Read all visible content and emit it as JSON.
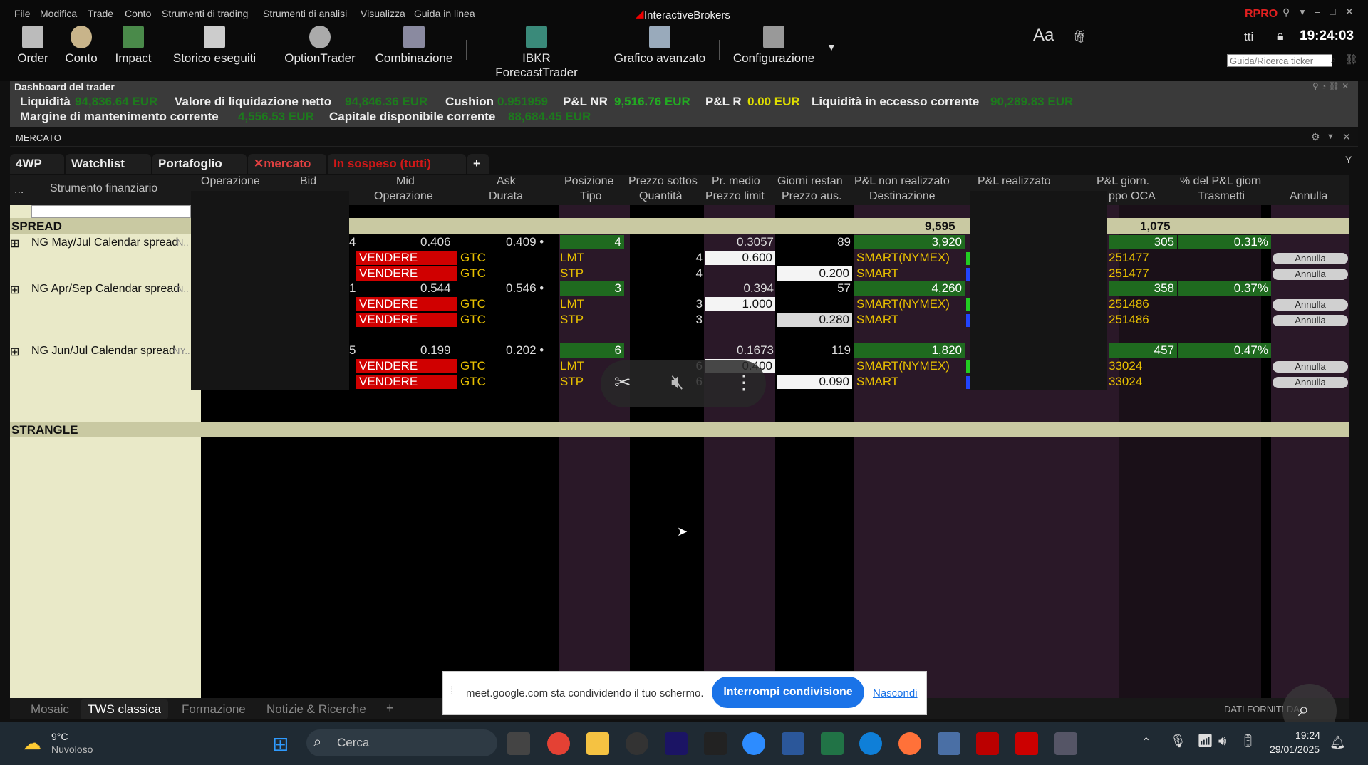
{
  "menu": {
    "file": "File",
    "edit": "Modifica",
    "trade": "Trade",
    "account": "Conto",
    "trading_tools": "Strumenti di trading",
    "analysis_tools": "Strumenti di analisi",
    "view": "Visualizza",
    "help": "Guida in linea"
  },
  "brand": "InteractiveBrokers",
  "pro_label": "RPRO",
  "clock": "19:24:03",
  "ticker_search_placeholder": "Guida/Ricerca ticker",
  "font_size_label": "Aa",
  "toolbar": {
    "order": "Order",
    "account": "Conto",
    "impact": "Impact",
    "trades": "Storico eseguiti",
    "optiontrader": "OptionTrader",
    "combo": "Combinazione",
    "forecast": "IBKR ForecastTrader",
    "chart": "Grafico avanzato",
    "config": "Configurazione"
  },
  "dashboard": {
    "title": "Dashboard del trader",
    "liq_label": "Liquidità",
    "liq_value": "94,836.64 EUR",
    "net_liq_label": "Valore di liquidazione netto",
    "net_liq_value": "94,846.36 EUR",
    "cushion_label": "Cushion",
    "cushion_value": "0.951959",
    "pnl_nr_label": "P&L NR",
    "pnl_nr_value": "9,516.76 EUR",
    "pnl_r_label": "P&L R",
    "pnl_r_value": "0.00 EUR",
    "excess_label": "Liquidità in eccesso corrente",
    "excess_value": "90,289.83 EUR",
    "margin_label": "Margine di mantenimento corrente",
    "margin_value": "4,556.53 EUR",
    "avail_label": "Capitale disponibile corrente",
    "avail_value": "88,684.45 EUR"
  },
  "panel_title": "MERCATO",
  "tabs": {
    "t1": "4WP",
    "t2": "Watchlist",
    "t3": "Portafoglio",
    "t4": "mercato",
    "t5": "In sospeso (tutti)",
    "add": "+"
  },
  "headers1": {
    "dots": "...",
    "instrument": "Strumento finanziario",
    "operation": "Operazione",
    "bid": "Bid",
    "mid": "Mid",
    "ask": "Ask",
    "position": "Posizione",
    "underlying": "Prezzo sottos",
    "avg_price": "Pr. medio",
    "days": "Giorni restan",
    "unrealized": "P&L non realizzato",
    "realized": "P&L realizzato",
    "daily_pnl": "P&L giorn.",
    "daily_pct": "% del P&L giorn"
  },
  "headers2": {
    "operation": "Operazione",
    "duration": "Durata",
    "type": "Tipo",
    "quantity": "Quantità",
    "limit": "Prezzo limit",
    "aux": "Prezzo aus.",
    "dest": "Destinazione",
    "oca": "ppo OCA",
    "transmit": "Trasmetti",
    "cancel": "Annulla"
  },
  "groups": {
    "spread": "SPREAD",
    "spread_unrealized": "9,595",
    "spread_daily": "1,075",
    "strangle": "STRANGLE"
  },
  "positions": [
    {
      "name": "NG May/Jul Calendar spread",
      "suffix": "N..",
      "bid_frag": "4",
      "mid": "0.406",
      "ask": "0.409 •",
      "pos": "4",
      "avg": "0.3057",
      "days": "89",
      "unreal": "3,920",
      "daily": "305",
      "pct": "0.31%",
      "orders": [
        {
          "side": "VENDERE",
          "tif": "GTC",
          "type": "LMT",
          "qty": "4",
          "limit": "0.600",
          "aux": "",
          "dest": "SMART(NYMEX)",
          "oca": "251477",
          "cancel": "Annulla"
        },
        {
          "side": "VENDERE",
          "tif": "GTC",
          "type": "STP",
          "qty": "4",
          "limit": "",
          "aux": "0.200",
          "dest": "SMART",
          "oca": "251477",
          "cancel": "Annulla"
        }
      ]
    },
    {
      "name": "NG Apr/Sep Calendar spread",
      "suffix": "N..",
      "bid_frag": "1",
      "mid": "0.544",
      "ask": "0.546 •",
      "pos": "3",
      "avg": "0.394",
      "days": "57",
      "unreal": "4,260",
      "daily": "358",
      "pct": "0.37%",
      "orders": [
        {
          "side": "VENDERE",
          "tif": "GTC",
          "type": "LMT",
          "qty": "3",
          "limit": "1.000",
          "aux": "",
          "dest": "SMART(NYMEX)",
          "oca": "251486",
          "cancel": "Annulla"
        },
        {
          "side": "VENDERE",
          "tif": "GTC",
          "type": "STP",
          "qty": "3",
          "limit": "",
          "aux": "0.280",
          "dest": "SMART",
          "oca": "251486",
          "cancel": "Annulla"
        }
      ]
    },
    {
      "name": "NG Jun/Jul Calendar spread",
      "suffix": "NY..",
      "bid_frag": "5",
      "mid": "0.199",
      "ask": "0.202 •",
      "pos": "6",
      "avg": "0.1673",
      "days": "119",
      "unreal": "1,820",
      "daily": "457",
      "pct": "0.47%",
      "orders": [
        {
          "side": "VENDERE",
          "tif": "GTC",
          "type": "LMT",
          "qty": "6",
          "limit": "0.400",
          "aux": "",
          "dest": "SMART(NYMEX)",
          "oca": "33024",
          "cancel": "Annulla"
        },
        {
          "side": "VENDERE",
          "tif": "GTC",
          "type": "STP",
          "qty": "6",
          "limit": "",
          "aux": "0.090",
          "dest": "SMART",
          "oca": "33024",
          "cancel": "Annulla"
        }
      ]
    }
  ],
  "bottom_tabs": {
    "mosaic": "Mosaic",
    "classic": "TWS classica",
    "training": "Formazione",
    "news": "Notizie & Ricerche",
    "add": "+"
  },
  "data_provided": "DATI FORNITI DA",
  "sharing": {
    "message": "meet.google.com sta condividendo il tuo schermo.",
    "stop": "Interrompi condivisione",
    "hide": "Nascondi"
  },
  "taskbar": {
    "temp": "9°C",
    "weather": "Nuvoloso",
    "search": "Cerca",
    "time": "19:24",
    "date": "29/01/2025"
  }
}
